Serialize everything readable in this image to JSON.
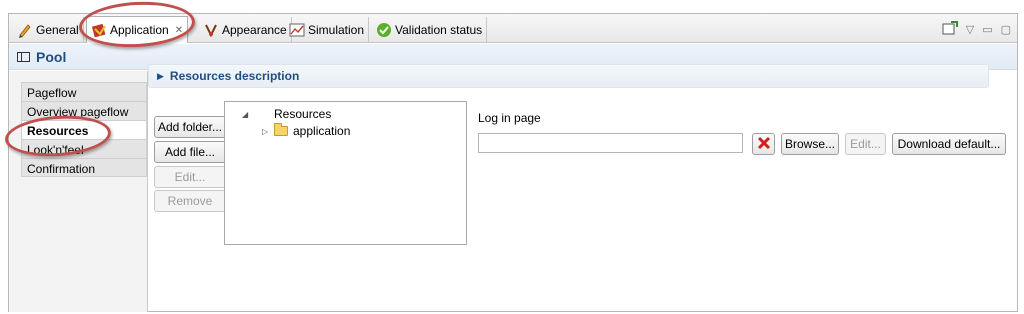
{
  "tabs": [
    {
      "label": "General",
      "icon": "pencil-icon"
    },
    {
      "label": "Application",
      "icon": "application-icon",
      "active": true,
      "close": "✕"
    },
    {
      "label": "Appearance",
      "icon": "appearance-icon"
    },
    {
      "label": "Simulation",
      "icon": "simulation-chart-icon"
    },
    {
      "label": "Validation status",
      "icon": "check-circle-icon"
    }
  ],
  "header": {
    "title": "Pool"
  },
  "nav": {
    "items": [
      "Pageflow",
      "Overview pageflow",
      "Resources",
      "Look'n'feel",
      "Confirmation"
    ],
    "selected": "Resources"
  },
  "section": {
    "title": "Resources description"
  },
  "buttons": {
    "add_folder": "Add folder...",
    "add_file": "Add file...",
    "edit": "Edit...",
    "remove": "Remove"
  },
  "tree": {
    "root": "Resources",
    "children": [
      "application"
    ]
  },
  "login": {
    "label": "Log in page",
    "value": "",
    "browse": "Browse...",
    "edit": "Edit...",
    "download": "Download default..."
  },
  "colors": {
    "accent": "#1f4f82",
    "annotation": "#c0504d"
  }
}
